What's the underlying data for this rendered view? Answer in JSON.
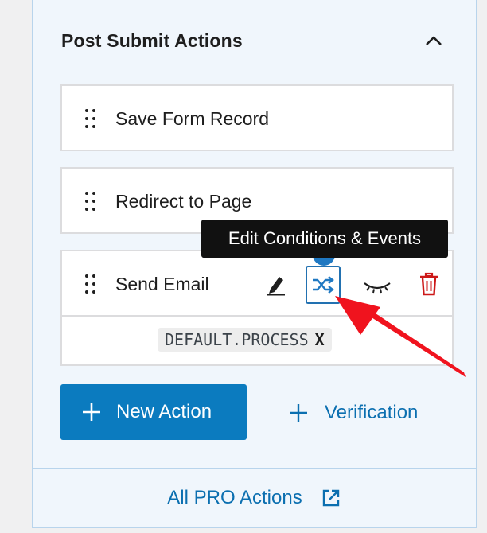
{
  "panel": {
    "title": "Post Submit Actions"
  },
  "actions": [
    {
      "label": "Save Form Record"
    },
    {
      "label": "Redirect to Page"
    },
    {
      "label": "Send Email",
      "events": [
        "DEFAULT.PROCESS"
      ],
      "remove_tag_label": "X"
    }
  ],
  "tooltip": {
    "text": "Edit Conditions & Events"
  },
  "buttons": {
    "new_action": "New Action",
    "verification": "Verification"
  },
  "footer": {
    "pro_link": "All PRO Actions"
  },
  "icons": {
    "collapse": "chevron-up-icon",
    "drag": "drag-handle-icon",
    "edit": "pencil-icon",
    "conditions": "shuffle-icon",
    "visibility": "eye-closed-icon",
    "delete": "trash-icon",
    "add": "plus-icon",
    "external": "external-link-icon"
  },
  "colors": {
    "accent": "#0b7bbf",
    "danger": "#cc1818",
    "annotation": "#f0131e"
  }
}
